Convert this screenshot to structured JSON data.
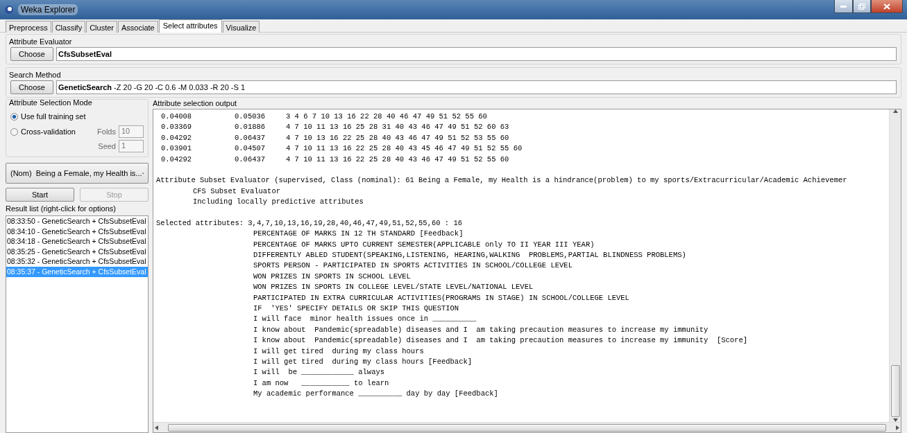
{
  "window": {
    "title": "Weka Explorer"
  },
  "tabs": [
    {
      "label": "Preprocess",
      "selected": false
    },
    {
      "label": "Classify",
      "selected": false
    },
    {
      "label": "Cluster",
      "selected": false
    },
    {
      "label": "Associate",
      "selected": false
    },
    {
      "label": "Select attributes",
      "selected": true
    },
    {
      "label": "Visualize",
      "selected": false
    }
  ],
  "evaluator": {
    "title": "Attribute Evaluator",
    "button": "Choose",
    "name": "CfsSubsetEval"
  },
  "search_method": {
    "title": "Search Method",
    "button": "Choose",
    "name": "GeneticSearch",
    "options": "-Z 20 -G 20 -C 0.6 -M 0.033 -R 20 -S 1"
  },
  "mode": {
    "title": "Attribute Selection Mode",
    "options": [
      {
        "label": "Use full training set",
        "selected": true
      },
      {
        "label": "Cross-validation",
        "selected": false
      }
    ],
    "folds_label": "Folds",
    "folds": "10",
    "seed_label": "Seed",
    "seed": "1"
  },
  "class_select": {
    "value": "(Nom)  Being a Female, my Health is..."
  },
  "start_button": {
    "label": "Start",
    "disabled": false
  },
  "stop_button": {
    "label": "Stop",
    "disabled": true
  },
  "result_list": {
    "title": "Result list (right-click for options)",
    "items": [
      {
        "label": "08:33:50 - GeneticSearch + CfsSubsetEval",
        "selected": false
      },
      {
        "label": "08:34:10 - GeneticSearch + CfsSubsetEval",
        "selected": false
      },
      {
        "label": "08:34:18 - GeneticSearch + CfsSubsetEval",
        "selected": false
      },
      {
        "label": "08:35:25 - GeneticSearch + CfsSubsetEval",
        "selected": false
      },
      {
        "label": "08:35:32 - GeneticSearch + CfsSubsetEval",
        "selected": false
      },
      {
        "label": "08:35:37 - GeneticSearch + CfsSubsetEval",
        "selected": true
      }
    ]
  },
  "output": {
    "title": "Attribute selection output",
    "rows": [
      {
        "column_1": "0.04008",
        "column_2": "0.05036",
        "column_3": "3 4 6 7 10 13 16 22 28 40 46 47 49 51 52 55 60"
      },
      {
        "column_1": "0.03369",
        "column_2": "0.01886",
        "column_3": "4 7 10 11 13 16 25 28 31 40 43 46 47 49 51 52 60 63"
      },
      {
        "column_1": "0.04292",
        "column_2": "0.06437",
        "column_3": "4 7 10 13 16 22 25 28 40 43 46 47 49 51 52 53 55 60"
      },
      {
        "column_1": "0.03901",
        "column_2": "0.04507",
        "column_3": "4 7 10 11 13 16 22 25 28 40 43 45 46 47 49 51 52 55 60"
      },
      {
        "column_1": "0.04292",
        "column_2": "0.06437",
        "column_3": "4 7 10 11 13 16 22 25 28 40 43 46 47 49 51 52 55 60"
      }
    ],
    "evaluator_line": "Attribute Subset Evaluator (supervised, Class (nominal): 61 Being a Female, my Health is a hindrance(problem) to my sports/Extracurricular/Academic Achievemer",
    "evaluator_details": [
      "CFS Subset Evaluator",
      "Including locally predictive attributes"
    ],
    "selected_line": "Selected attributes: 3,4,7,10,13,16,19,28,40,46,47,49,51,52,55,60 : 16",
    "attributes": [
      "PERCENTAGE OF MARKS IN 12 TH STANDARD [Feedback]",
      "PERCENTAGE OF MARKS UPTO CURRENT SEMESTER(APPLICABLE only TO II YEAR III YEAR)",
      "DIFFERENTLY ABLED STUDENT(SPEAKING,LISTENING, HEARING,WALKING  PROBLEMS,PARTIAL BLINDNESS PROBLEMS)",
      "SPORTS PERSON - PARTICIPATED IN SPORTS ACTIVITIES IN SCHOOL/COLLEGE LEVEL",
      "WON PRIZES IN SPORTS IN SCHOOL LEVEL",
      "WON PRIZES IN SPORTS IN COLLEGE LEVEL/STATE LEVEL/NATIONAL LEVEL",
      "PARTICIPATED IN EXTRA CURRICULAR ACTIVITIES(PROGRAMS IN STAGE) IN SCHOOL/COLLEGE LEVEL",
      "IF  'YES' SPECIFY DETAILS OR SKIP THIS QUESTION",
      "I will face  minor health issues once in __________",
      "I know about  Pandemic(spreadable) diseases and I  am taking precaution measures to increase my immunity",
      "I know about  Pandemic(spreadable) diseases and I  am taking precaution measures to increase my immunity  [Score]",
      "I will get tired  during my class hours",
      "I will get tired  during my class hours [Feedback]",
      "I will  be ____________ always",
      "I am now   ___________ to learn",
      "My academic performance __________ day by day [Feedback]"
    ]
  }
}
